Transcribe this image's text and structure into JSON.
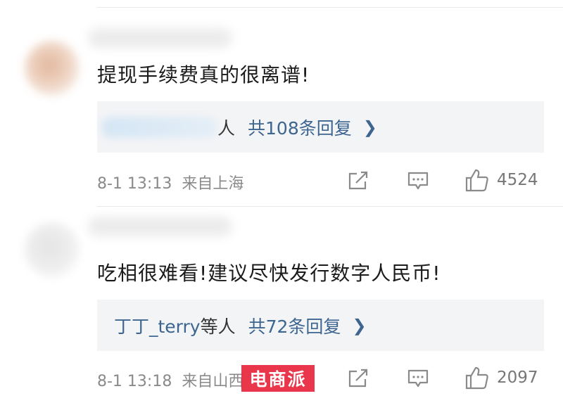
{
  "comments": [
    {
      "text": "提现手续费真的很离谱!",
      "reply_users": "",
      "reply_suffix": "人",
      "reply_count": "共108条回复",
      "time": "8-1 13:13",
      "location": "来自上海",
      "likes": "4524"
    },
    {
      "text": "吃相很难看!建议尽快发行数字人民币!",
      "reply_users": "丁丁_terry",
      "reply_suffix": "等人",
      "reply_count": "共72条回复",
      "time": "8-1 13:18",
      "location": "来自山西",
      "likes": "2097"
    }
  ],
  "watermark": "电商派",
  "icons": {
    "chevron": "chevron-right-icon",
    "share": "share-icon",
    "comment": "comment-icon",
    "like": "thumbs-up-icon"
  },
  "colors": {
    "link": "#3d6590",
    "reply_bg": "#f3f4f6",
    "meta": "#8a8a8a",
    "watermark_bg": "#e8253c"
  }
}
